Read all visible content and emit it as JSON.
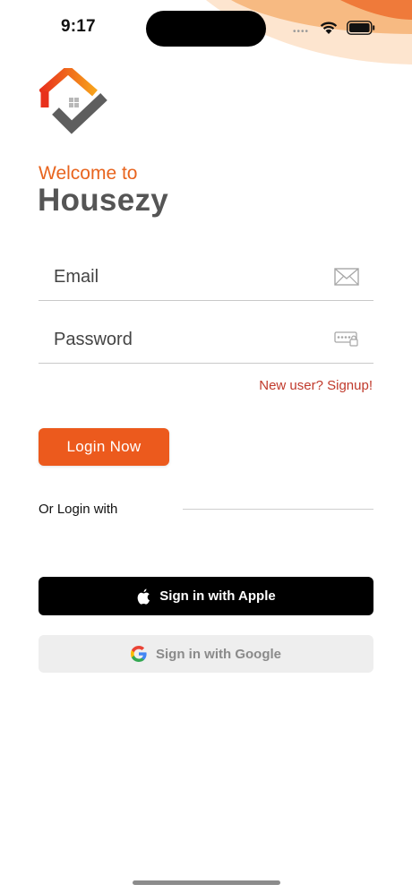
{
  "status_bar": {
    "time": "9:17",
    "icons": [
      "signal-dots-icon",
      "wifi-icon",
      "battery-icon"
    ]
  },
  "brand": {
    "welcome": "Welcome to",
    "name": "Housezy",
    "logo_icon": "house-check-logo"
  },
  "form": {
    "email": {
      "placeholder": "Email",
      "value": "",
      "icon": "mail-icon"
    },
    "password": {
      "placeholder": "Password",
      "value": "",
      "icon": "password-keypad-icon"
    },
    "signup_link": "New user? Signup!",
    "login_button": "Login Now"
  },
  "social": {
    "or_label": "Or Login with",
    "apple_button": "Sign in with Apple",
    "apple_icon": "apple-icon",
    "google_button": "Sign in with Google",
    "google_icon": "google-icon"
  },
  "colors": {
    "accent": "#ec5a1d",
    "welcome_text": "#e8641e",
    "brand_text": "#555555",
    "link": "#c0392b",
    "apple_bg": "#000000",
    "google_bg": "#eeeeee"
  }
}
